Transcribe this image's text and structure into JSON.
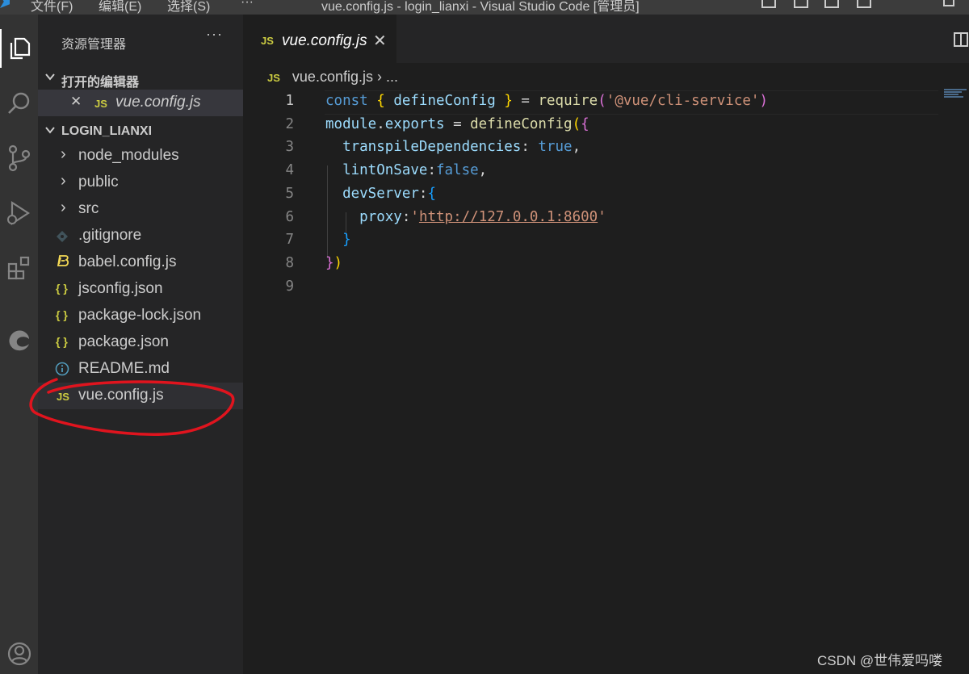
{
  "titlebar": {
    "menu": [
      "文件(F)",
      "编辑(E)",
      "选择(S)",
      "···"
    ],
    "title": "vue.config.js - login_lianxi - Visual Studio Code [管理员]"
  },
  "activitybar": {
    "icons": [
      "explorer-icon",
      "search-icon",
      "source-control-icon",
      "run-debug-icon",
      "extensions-icon",
      "edge-icon",
      "account-icon"
    ]
  },
  "sidebar": {
    "header": "资源管理器",
    "more": "···",
    "open_editors": {
      "title": "打开的编辑器",
      "files": [
        {
          "close": "✕",
          "icon": "JS",
          "name": "vue.config.js"
        }
      ]
    },
    "project": {
      "title": "LOGIN_LIANXI",
      "items": [
        {
          "type": "folder",
          "chevron": "›",
          "name": "node_modules"
        },
        {
          "type": "folder",
          "chevron": "›",
          "name": "public"
        },
        {
          "type": "folder",
          "chevron": "›",
          "name": "src"
        },
        {
          "type": "file",
          "icon": "git-icon",
          "name": ".gitignore"
        },
        {
          "type": "file",
          "icon": "babel-icon",
          "name": "babel.config.js"
        },
        {
          "type": "file",
          "icon": "{ }",
          "name": "jsconfig.json"
        },
        {
          "type": "file",
          "icon": "{ }",
          "name": "package-lock.json"
        },
        {
          "type": "file",
          "icon": "{ }",
          "name": "package.json"
        },
        {
          "type": "file",
          "icon": "info-icon",
          "name": "README.md"
        },
        {
          "type": "file",
          "icon": "JS",
          "name": "vue.config.js"
        }
      ]
    }
  },
  "editor": {
    "tab": {
      "icon": "JS",
      "name": "vue.config.js",
      "close": "✕"
    },
    "breadcrumb": {
      "icon": "JS",
      "file": "vue.config.js",
      "sep": "›",
      "rest": "..."
    },
    "line_numbers": [
      "1",
      "2",
      "3",
      "4",
      "5",
      "6",
      "7",
      "8",
      "9"
    ],
    "lines": [
      [
        [
          "kw",
          "const"
        ],
        [
          "punc",
          " "
        ],
        [
          "b1",
          "{"
        ],
        [
          "punc",
          " "
        ],
        [
          "var",
          "defineConfig"
        ],
        [
          "punc",
          " "
        ],
        [
          "b1",
          "}"
        ],
        [
          "punc",
          " = "
        ],
        [
          "fn",
          "require"
        ],
        [
          "b2",
          "("
        ],
        [
          "str",
          "'@vue/cli-service'"
        ],
        [
          "b2",
          ")"
        ]
      ],
      [
        [
          "var",
          "module"
        ],
        [
          "punc",
          "."
        ],
        [
          "var",
          "exports"
        ],
        [
          "punc",
          " = "
        ],
        [
          "fn",
          "defineConfig"
        ],
        [
          "b1",
          "("
        ],
        [
          "b2",
          "{"
        ]
      ],
      [
        [
          "punc",
          "  "
        ],
        [
          "var",
          "transpileDependencies"
        ],
        [
          "punc",
          ": "
        ],
        [
          "kw",
          "true"
        ],
        [
          "punc",
          ","
        ]
      ],
      [
        [
          "punc",
          "  "
        ],
        [
          "var",
          "lintOnSave"
        ],
        [
          "punc",
          ":"
        ],
        [
          "kw",
          "false"
        ],
        [
          "punc",
          ","
        ]
      ],
      [
        [
          "punc",
          "  "
        ],
        [
          "var",
          "devServer"
        ],
        [
          "punc",
          ":"
        ],
        [
          "b3",
          "{"
        ]
      ],
      [
        [
          "punc",
          "    "
        ],
        [
          "var",
          "proxy"
        ],
        [
          "punc",
          ":"
        ],
        [
          "str",
          "'"
        ],
        [
          "url",
          "http://127.0.0.1:8600"
        ],
        [
          "str",
          "'"
        ]
      ],
      [
        [
          "punc",
          "  "
        ],
        [
          "b3",
          "}"
        ]
      ],
      [
        [
          "b2",
          "}"
        ],
        [
          "b1",
          ")"
        ]
      ],
      []
    ]
  },
  "colors": {
    "keyword": "#569cd6",
    "variable": "#9cdcfe",
    "function": "#dcdcaa",
    "string": "#ce9178",
    "annotation": "#e0141e"
  },
  "watermark": "CSDN @世伟爱吗喽"
}
